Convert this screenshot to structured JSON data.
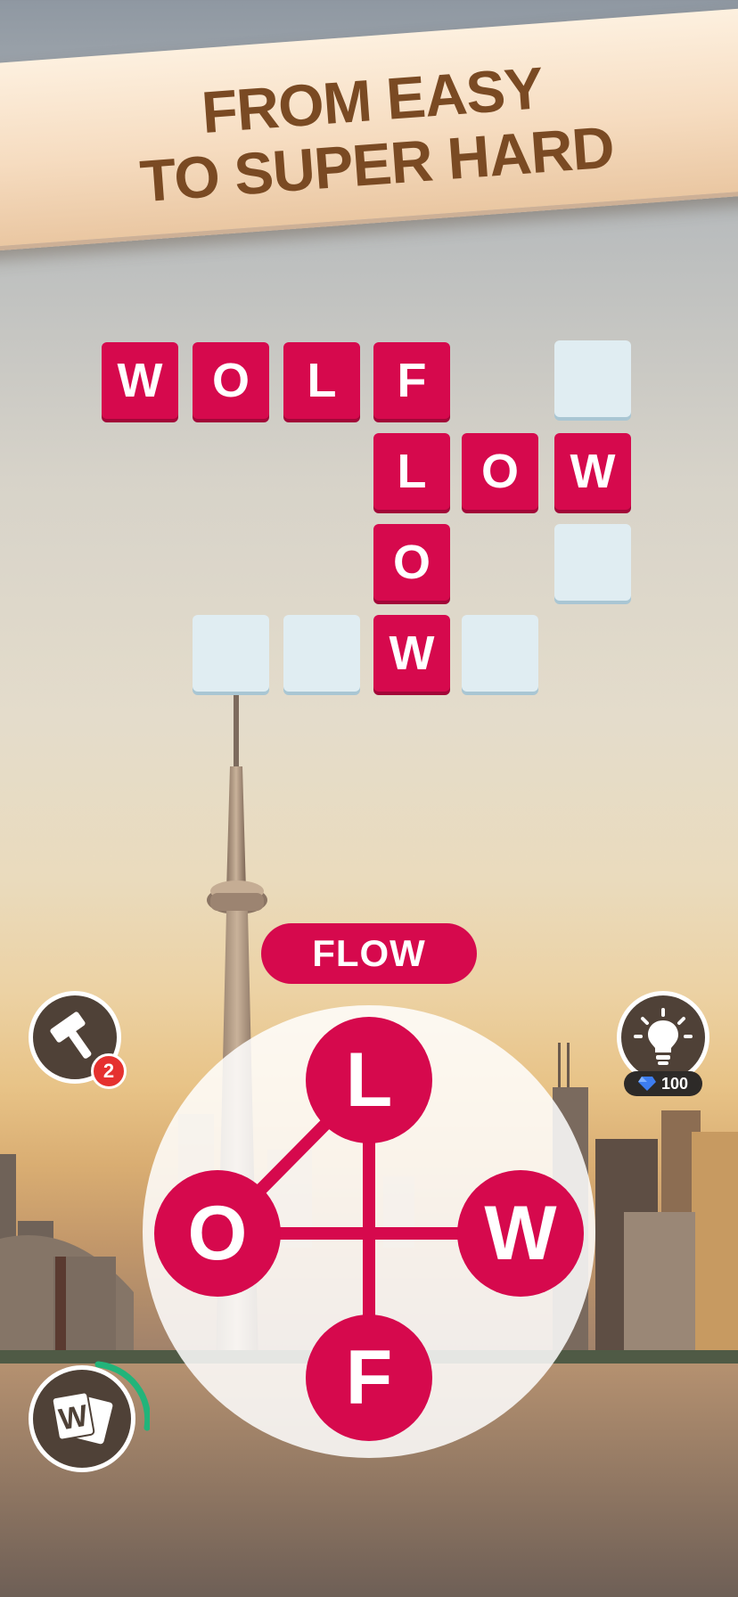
{
  "banner": {
    "line1": "FROM EASY",
    "line2": "TO SUPER HARD"
  },
  "board": {
    "tiles": [
      {
        "letter": "W",
        "filled": true
      },
      {
        "letter": "O",
        "filled": true
      },
      {
        "letter": "L",
        "filled": true
      },
      {
        "letter": "F",
        "filled": true
      },
      {
        "letter": "",
        "filled": false
      },
      {
        "letter": "L",
        "filled": true
      },
      {
        "letter": "O",
        "filled": true
      },
      {
        "letter": "W",
        "filled": true
      },
      {
        "letter": "O",
        "filled": true
      },
      {
        "letter": "",
        "filled": false
      },
      {
        "letter": "",
        "filled": false
      },
      {
        "letter": "",
        "filled": false
      },
      {
        "letter": "W",
        "filled": true
      },
      {
        "letter": "",
        "filled": false
      }
    ]
  },
  "current_word": "FLOW",
  "wheel": {
    "letters": [
      "L",
      "O",
      "W",
      "F"
    ]
  },
  "hammer": {
    "icon": "hammer-icon",
    "count": "2"
  },
  "hint": {
    "icon": "lightbulb-icon",
    "gem_icon": "gem-icon",
    "cost": "100"
  },
  "dictionary": {
    "icon": "word-cards-icon",
    "letter": "W"
  },
  "colors": {
    "accent": "#d6094d",
    "empty_tile": "#e0edf2",
    "banner_text": "#7a4a23"
  }
}
